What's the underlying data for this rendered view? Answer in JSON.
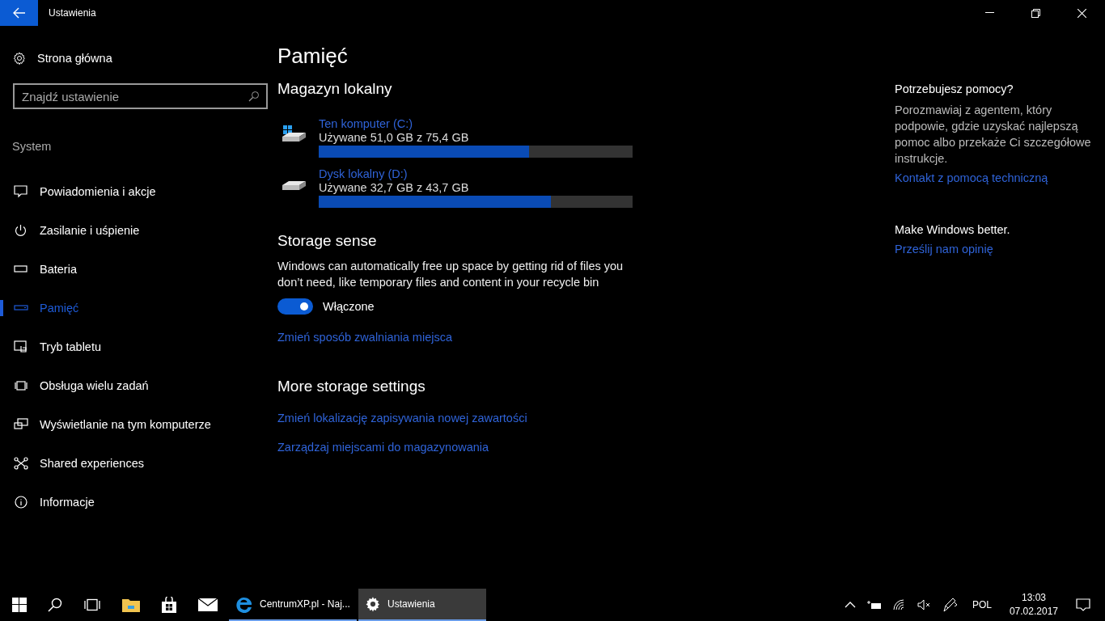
{
  "window": {
    "title": "Ustawienia"
  },
  "sidebar": {
    "home": "Strona główna",
    "search": {
      "placeholder": "Znajdź ustawienie"
    },
    "section": "System",
    "items": [
      {
        "label": "Powiadomienia i akcje",
        "selected": false
      },
      {
        "label": "Zasilanie i uśpienie",
        "selected": false
      },
      {
        "label": "Bateria",
        "selected": false
      },
      {
        "label": "Pamięć",
        "selected": true
      },
      {
        "label": "Tryb tabletu",
        "selected": false
      },
      {
        "label": "Obsługa wielu zadań",
        "selected": false
      },
      {
        "label": "Wyświetlanie na tym komputerze",
        "selected": false
      },
      {
        "label": "Shared experiences",
        "selected": false
      },
      {
        "label": "Informacje",
        "selected": false
      }
    ]
  },
  "page": {
    "title": "Pamięć",
    "local_heading": "Magazyn lokalny",
    "drives": [
      {
        "kind": "system",
        "name": "Ten komputer (C:)",
        "usage": "Używane 51,0 GB z 75,4 GB",
        "level": 0.67
      },
      {
        "kind": "data",
        "name": "Dysk lokalny (D:)",
        "usage": "Używane 32,7 GB z 43,7 GB",
        "level": 0.74
      }
    ],
    "sense_heading": "Storage sense",
    "sense_text": "Windows can automatically free up space by getting rid of files you don’t need, like temporary files and content in your recycle bin",
    "toggle": {
      "on": true,
      "label": "Włączone"
    },
    "sense_link": "Zmień sposób zwalniania miejsca",
    "more_heading": "More storage settings",
    "more_links": [
      "Zmień lokalizację zapisywania nowej zawartości",
      "Zarządzaj miejscami do magazynowania"
    ]
  },
  "help": {
    "heading": "Potrzebujesz pomocy?",
    "text": "Porozmawiaj z agentem, który podpowie, gdzie uzyskać najlepszą pomoc albo przekaże Ci szczegółowe instrukcje.",
    "link": "Kontakt z pomocą techniczną",
    "feedback_heading": "Make Windows better.",
    "feedback_link": "Prześlij nam opinię"
  },
  "taskbar": {
    "apps": [
      {
        "label": "CentrumXP.pl - Naj...",
        "selected": false
      },
      {
        "label": "Ustawienia",
        "selected": true
      }
    ],
    "language": "POL",
    "time": "13:03",
    "date": "07.02.2017"
  }
}
